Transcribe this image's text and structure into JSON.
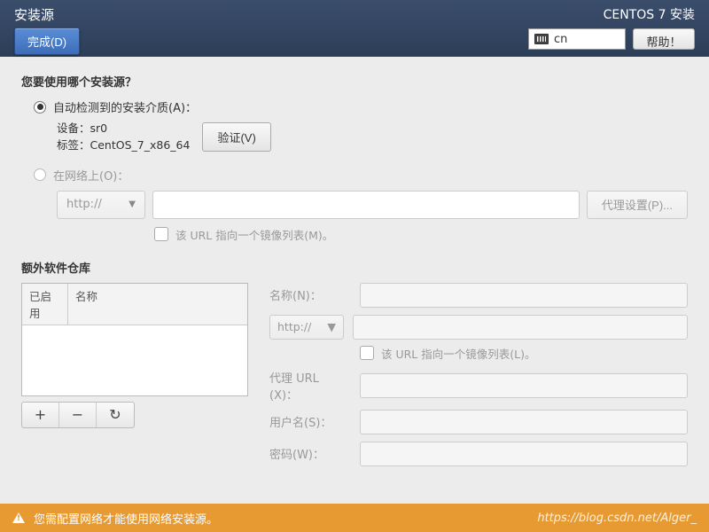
{
  "header": {
    "page_title": "安装源",
    "done_label": "完成(D)",
    "distro_title": "CENTOS 7 安装",
    "keyboard_layout": "cn",
    "help_label": "帮助！"
  },
  "source": {
    "question": "您要使用哪个安装源？",
    "auto_radio_label": "自动检测到的安装介质(A)：",
    "device_label": "设备：",
    "device_value": "sr0",
    "label_label": "标签：",
    "label_value": "CentOS_7_x86_64",
    "verify_label": "验证(V)",
    "network_radio_label": "在网络上(O)：",
    "protocol_value": "http://",
    "proxy_btn_label": "代理设置(P)...",
    "mirror_checkbox_label": "该 URL 指向一个镜像列表(M)。"
  },
  "extra": {
    "title": "额外软件仓库",
    "col_enabled": "已启用",
    "col_name": "名称",
    "form": {
      "name_label": "名称(N)：",
      "protocol_value": "http://",
      "mirror_checkbox_label": "该 URL 指向一个镜像列表(L)。",
      "proxy_url_label": "代理 URL (X)：",
      "user_label": "用户名(S)：",
      "password_label": "密码(W)："
    }
  },
  "footer": {
    "warning": "您需配置网络才能使用网络安装源。",
    "watermark": "https://blog.csdn.net/Alger_"
  }
}
